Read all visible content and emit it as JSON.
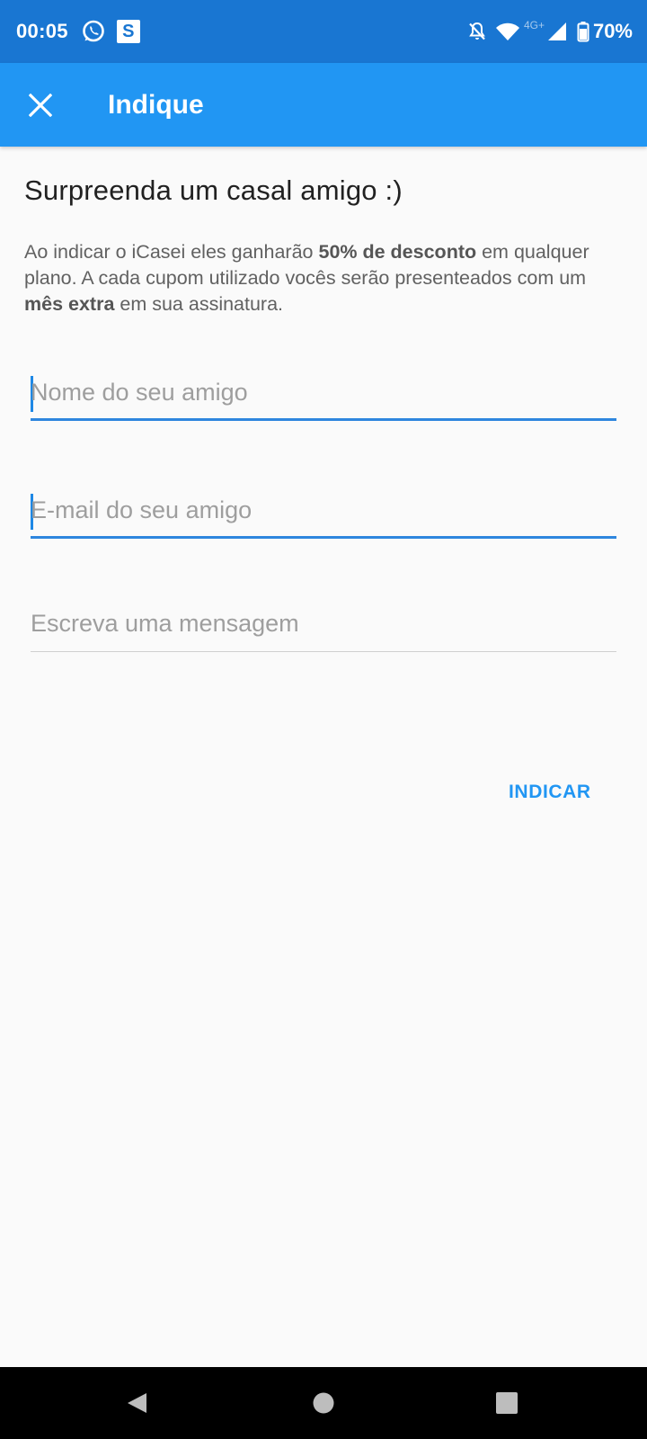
{
  "status_bar": {
    "time": "00:05",
    "network_label": "4G+",
    "battery": "70%",
    "icons": [
      "whatsapp-icon",
      "s-app-icon",
      "notifications-off-icon",
      "wifi-icon",
      "signal-icon",
      "battery-icon"
    ],
    "s_badge_letter": "S"
  },
  "app_bar": {
    "title": "Indique",
    "close_icon": "close-icon"
  },
  "content": {
    "heading": "Surpreenda um casal amigo :)",
    "description": {
      "part1": "Ao indicar o iCasei eles ganharão ",
      "bold1": "50% de desconto",
      "part2": " em qualquer plano. A cada cupom utilizado vocês serão presenteados com um ",
      "bold2": "mês extra",
      "part3": " em sua assinatura."
    }
  },
  "form": {
    "name": {
      "placeholder": "Nome do seu amigo",
      "value": ""
    },
    "email": {
      "placeholder": "E-mail do seu amigo",
      "value": ""
    },
    "message": {
      "placeholder": "Escreva uma mensagem",
      "value": ""
    },
    "submit_label": "INDICAR"
  },
  "colors": {
    "status_bar": "#1976d2",
    "app_bar": "#2196f3",
    "accent": "#2196f3",
    "background": "#fafafa"
  },
  "nav_bar": {
    "icons": [
      "back-icon",
      "home-icon",
      "recents-icon"
    ]
  }
}
